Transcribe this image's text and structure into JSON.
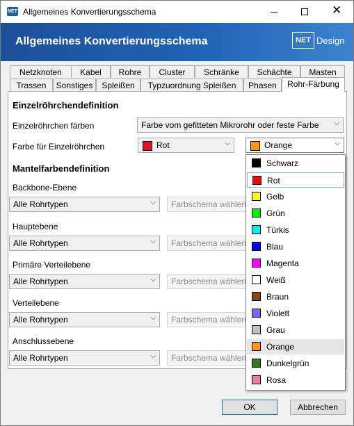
{
  "window": {
    "title": "Allgemeines Konvertierungsschema",
    "app_icon": "NET",
    "minimize_glyph": "—",
    "close_glyph": "✕"
  },
  "header": {
    "title": "Allgemeines Konvertierungsschema",
    "logo": "NET",
    "brand": "Design"
  },
  "tabs_row1": [
    "Netzknoten",
    "Kabel",
    "Rohre",
    "Cluster",
    "Schränke",
    "Schächte",
    "Masten"
  ],
  "tabs_row2": [
    "Trassen",
    "Sonstiges",
    "Spleißen",
    "Typzuordnung Spleißen",
    "Phasen",
    "Rohr-Färbung"
  ],
  "active_tab": "Rohr-Färbung",
  "einzel": {
    "heading": "Einzelröhrchendefinition",
    "faerben_label": "Einzelröhrchen färben",
    "faerben_value": "Farbe vom gefitteten Mikrorohr oder feste Farbe",
    "farbe_label": "Farbe für Einzelröhrchen",
    "farbe1": {
      "label": "Rot",
      "color": "#e81123"
    },
    "farbe2": {
      "label": "Orange",
      "color": "#ff9900"
    }
  },
  "mantel": {
    "heading": "Mantelfarbendefinition",
    "levels": [
      {
        "label": "Backbone-Ebene",
        "type": "Alle Rohrtypen",
        "scheme": "Farbschema wählen"
      },
      {
        "label": "Hauptebene",
        "type": "Alle Rohrtypen",
        "scheme": "Farbschema wählen"
      },
      {
        "label": "Primäre Verteilebene",
        "type": "Alle Rohrtypen",
        "scheme": "Farbschema wählen"
      },
      {
        "label": "Verteilebene",
        "type": "Alle Rohrtypen",
        "scheme": "Farbschema wählen"
      },
      {
        "label": "Anschlussebene",
        "type": "Alle Rohrtypen",
        "scheme": "Farbschema wählen"
      }
    ]
  },
  "dropdown_options": [
    {
      "label": "Schwarz",
      "color": "#000000"
    },
    {
      "label": "Rot",
      "color": "#ff0000"
    },
    {
      "label": "Gelb",
      "color": "#ffff00"
    },
    {
      "label": "Grün",
      "color": "#00ee00"
    },
    {
      "label": "Türkis",
      "color": "#00f0f0"
    },
    {
      "label": "Blau",
      "color": "#0000ff"
    },
    {
      "label": "Magenta",
      "color": "#ff00ff"
    },
    {
      "label": "Weiß",
      "color": "#ffffff"
    },
    {
      "label": "Braun",
      "color": "#8b4513"
    },
    {
      "label": "Violett",
      "color": "#7b68ee"
    },
    {
      "label": "Grau",
      "color": "#c0c0c0"
    },
    {
      "label": "Orange",
      "color": "#ff9900"
    },
    {
      "label": "Dunkelgrün",
      "color": "#2e7d1a"
    },
    {
      "label": "Rosa",
      "color": "#f08090"
    }
  ],
  "dropdown_hover": "Rot",
  "dropdown_selected": "Orange",
  "buttons": {
    "ok": "OK",
    "cancel": "Abbrechen"
  }
}
